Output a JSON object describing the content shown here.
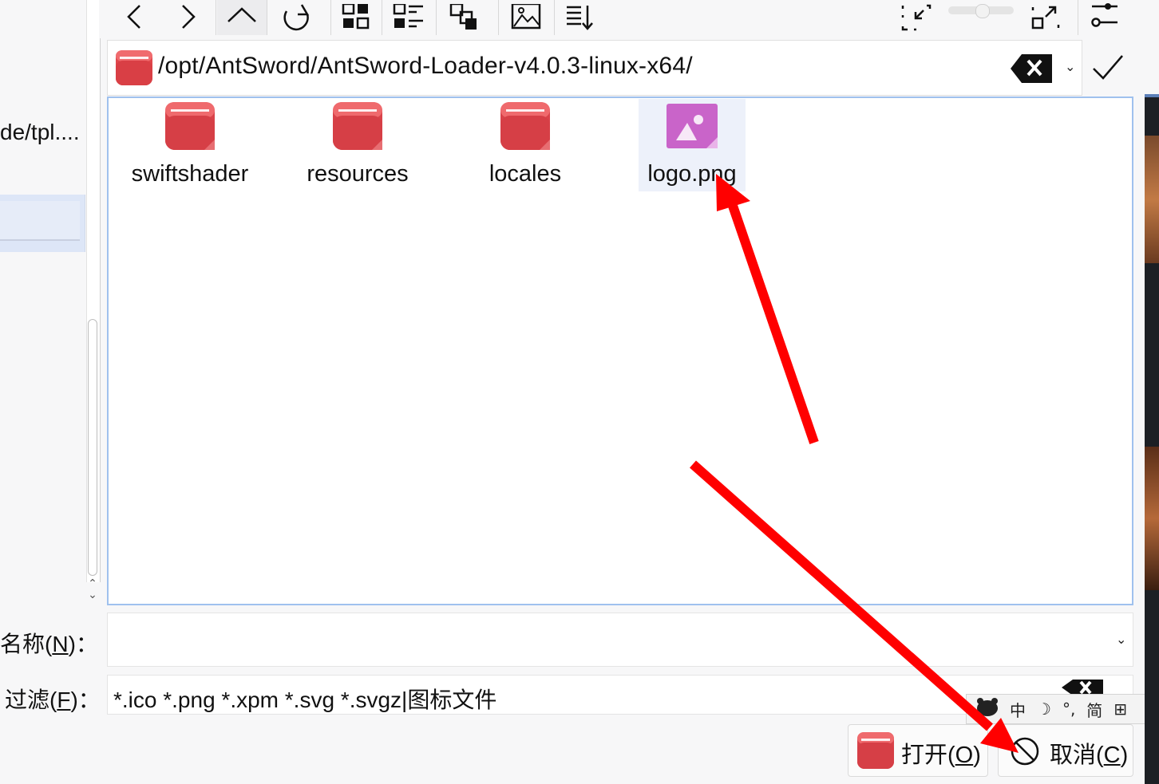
{
  "toolbar": {
    "buttons": [
      {
        "name": "back-button",
        "icon": "chevron-left-icon"
      },
      {
        "name": "forward-button",
        "icon": "chevron-right-icon"
      },
      {
        "name": "parent-folder-button",
        "icon": "chevron-up-icon"
      },
      {
        "name": "reload-button",
        "icon": "reload-icon"
      },
      {
        "name": "icon-view-button",
        "icon": "icon-view-icon"
      },
      {
        "name": "detail-view-button",
        "icon": "detail-view-icon"
      },
      {
        "name": "tree-view-button",
        "icon": "tree-view-icon"
      },
      {
        "name": "preview-button",
        "icon": "image-preview-icon"
      },
      {
        "name": "sort-button",
        "icon": "sort-icon"
      },
      {
        "name": "zoom-out-button",
        "icon": "shrink-icon"
      },
      {
        "name": "zoom-in-button",
        "icon": "expand-icon"
      },
      {
        "name": "options-button",
        "icon": "settings-sliders-icon"
      }
    ],
    "zoom_level": 0.5
  },
  "sidebar": {
    "visible_path": "de/tpl...."
  },
  "address_bar": {
    "path": "/opt/AntSword/AntSword-Loader-v4.0.3-linux-x64/"
  },
  "files": [
    {
      "name": "swiftshader",
      "type": "folder"
    },
    {
      "name": "resources",
      "type": "folder"
    },
    {
      "name": "locales",
      "type": "folder"
    },
    {
      "name": "logo.png",
      "type": "image"
    }
  ],
  "name_field": {
    "label_prefix": "名称(",
    "label_key": "N",
    "label_suffix": ")：",
    "value": ""
  },
  "filter_field": {
    "label_prefix": "过滤(",
    "label_key": "F",
    "label_suffix": ")：",
    "value": "*.ico *.png *.xpm *.svg *.svgz|图标文件"
  },
  "ime": {
    "items": [
      "中",
      "☽",
      "°,",
      "简",
      "⊞"
    ]
  },
  "buttons": {
    "open": {
      "prefix": "打开(",
      "key": "O",
      "suffix": ")"
    },
    "cancel": {
      "prefix": "取消(",
      "key": "C",
      "suffix": ")"
    }
  },
  "colors": {
    "folder_red": "#e0474c",
    "folder_top": "#f0676a",
    "image_purple": "#c964c9",
    "selection_blue": "#9fc1ee",
    "annotation_red": "#ff0000"
  }
}
